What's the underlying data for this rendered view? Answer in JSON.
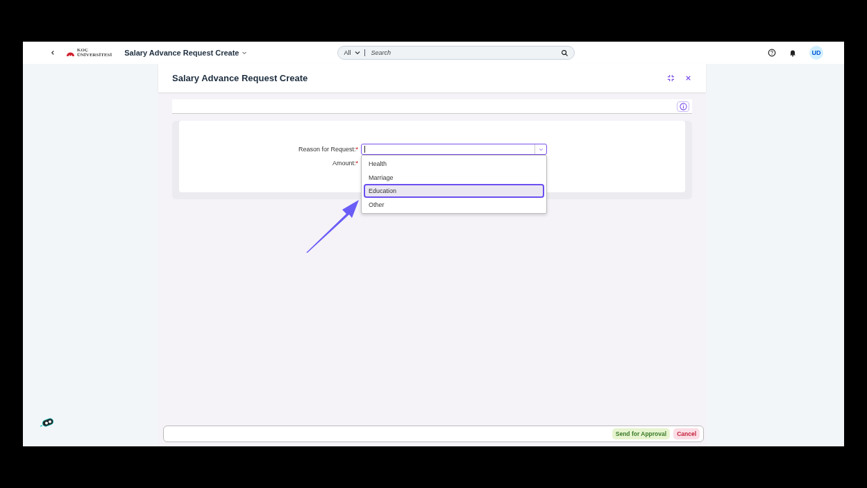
{
  "shell": {
    "logo_lines": [
      "KOÇ",
      "ÜNİVERSİTESİ"
    ],
    "app_title": "Salary Advance Request Create",
    "search": {
      "scope": "All",
      "placeholder": "Search"
    },
    "avatar": "UD"
  },
  "dialog": {
    "title": "Salary Advance Request Create",
    "fields": [
      {
        "label": "Reason for Request:",
        "required_mark": "*",
        "kind": "combo"
      },
      {
        "label": "Amount:",
        "required_mark": "*",
        "kind": "input"
      }
    ],
    "options": [
      {
        "label": "Health",
        "selected": false
      },
      {
        "label": "Marriage",
        "selected": false
      },
      {
        "label": "Education",
        "selected": true
      },
      {
        "label": "Other",
        "selected": false
      }
    ],
    "buttons": [
      {
        "label": "Send for Approval",
        "kind": "accept"
      },
      {
        "label": "Cancel",
        "kind": "reject"
      }
    ]
  }
}
